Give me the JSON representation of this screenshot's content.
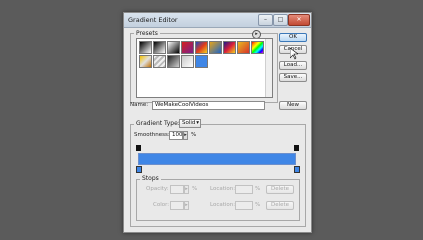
{
  "window": {
    "title": "Gradient Editor",
    "minimize": "–",
    "maximize": "□",
    "close": "✕"
  },
  "presets": {
    "label": "Presets",
    "menu_icon": "circle-arrow-icon",
    "swatches": [
      "linear-gradient(135deg,#000,#fff)",
      "linear-gradient(135deg,#000 0%,rgba(0,0,0,0) 100%)",
      "linear-gradient(135deg,#fff,#000)",
      "linear-gradient(135deg,#d4201c,#7a1f8f)",
      "linear-gradient(135deg,#1d4cc4,#e13b1d,#f2d21a)",
      "linear-gradient(135deg,#e3a31b,#1c64c8)",
      "linear-gradient(135deg,#1a1a8c,#d91f3a,#f5d31d)",
      "linear-gradient(135deg,#e8b820,#d7332a)",
      "linear-gradient(135deg,#ff0000,#ff9900,#ffff00,#00ff00,#00ffff,#0000ff,#ff00ff)",
      "linear-gradient(135deg,#f5c200,#e0e0e0,#c07000)",
      "repeating-linear-gradient(135deg,#f0f0f0 0 2px,#bbb 2px 4px)",
      "linear-gradient(135deg,#222,#cfcfcf)",
      "linear-gradient(135deg,#c8c8c8,#fff)",
      "linear-gradient(135deg,#3f86e6,#3f86e6)"
    ]
  },
  "buttons": {
    "ok": "OK",
    "cancel": "Cancel",
    "load": "Load...",
    "save": "Save..."
  },
  "name": {
    "label": "Name:",
    "value": "WeMakeCoolVideos",
    "new": "New"
  },
  "gradient_type": {
    "label": "Gradient Type:",
    "value": "Solid"
  },
  "smoothness": {
    "label": "Smoothness:",
    "value": "100",
    "unit": "%"
  },
  "stops": {
    "label": "Stops",
    "opacity_label": "Opacity:",
    "opacity_unit": "%",
    "color_label": "Color:",
    "location_label": "Location:",
    "location_unit": "%",
    "delete": "Delete"
  },
  "colors": {
    "gradient": "#3f86e6"
  }
}
